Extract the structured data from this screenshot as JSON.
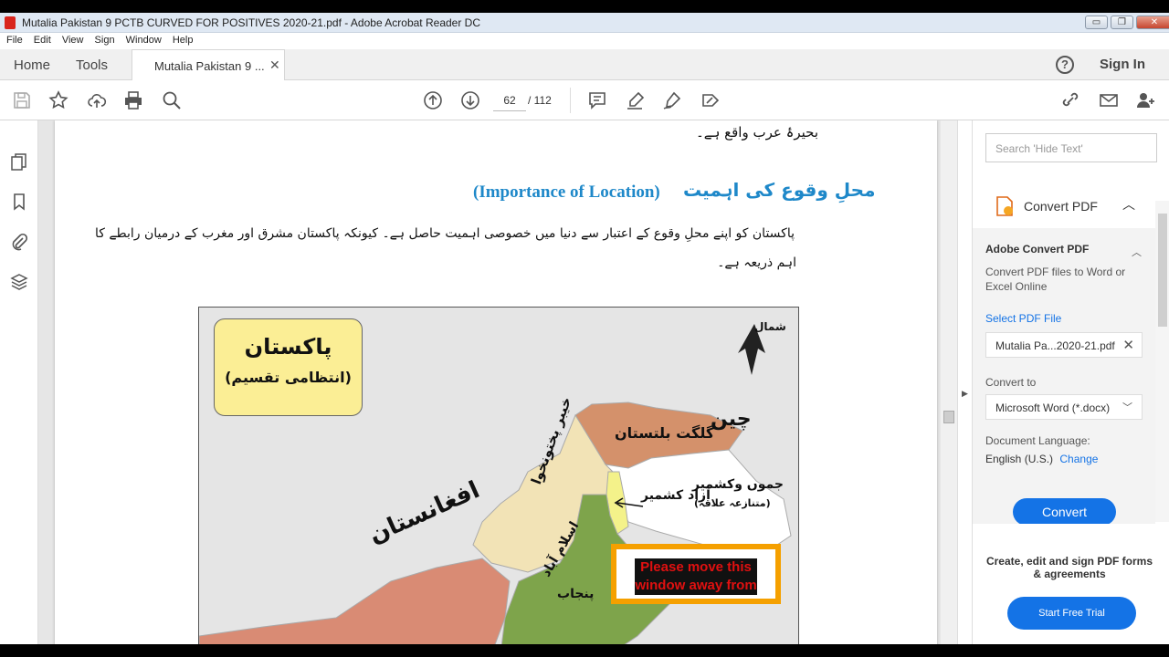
{
  "window": {
    "title": "Mutalia Pakistan 9 PCTB CURVED FOR POSITIVES 2020-21.pdf - Adobe Acrobat Reader DC",
    "min": "▭",
    "max": "❐",
    "close": "✕"
  },
  "menu": [
    "File",
    "Edit",
    "View",
    "Sign",
    "Window",
    "Help"
  ],
  "tabs": {
    "home": "Home",
    "tools": "Tools",
    "doc": "Mutalia Pakistan 9 ...",
    "close": "✕",
    "help": "?",
    "signin": "Sign In"
  },
  "toolbar": {
    "page_current": "62",
    "page_total": "/ 112"
  },
  "document": {
    "line_top": "بحیرۂ عرب واقع ہے۔",
    "heading_urdu": "محلِ وقوع کی اہمیت",
    "heading_english": "(Importance of Location)",
    "para_line1": "پاکستان کو اپنے محلِ وقوع کے اعتبار سے دنیا میں خصوصی اہمیت حاصل ہے۔ کیونکہ پاکستان مشرق اور مغرب کے درمیان رابطے کا",
    "para_line2": "اہم ذریعہ ہے۔",
    "map": {
      "legend_title": "پاکستان",
      "legend_subtitle": "(انتظامی تقسیم)",
      "north": "شمال",
      "china": "چین",
      "gilgit": "گلگت بلتستان",
      "kashmir": "جموں وکشمیر",
      "kashmir_note": "(متنازعہ علاقہ)",
      "azad_kashmir": "آزاد کشمیر",
      "kpk": "خیبر پختونخوا",
      "afghanistan": "افغانستان",
      "islamabad": "اسلام آباد",
      "punjab": "پنجاب",
      "colors": {
        "gilgit": "#d4916b",
        "kpk": "#f2e3b6",
        "punjab": "#7ea44b",
        "azad": "#f4f28a",
        "kashmir": "#ffffff",
        "balochistan": "#d98b74",
        "background": "#e5e5e5"
      }
    },
    "popup": "Please move this window away from"
  },
  "right_panel": {
    "search_placeholder": "Search 'Hide Text'",
    "convert_header": "Convert PDF",
    "section_title": "Adobe Convert PDF",
    "section_desc": "Convert PDF files to Word or Excel Online",
    "select_link": "Select PDF File",
    "file_name": "Mutalia Pa...2020-21.pdf",
    "convert_to_label": "Convert to",
    "convert_to_value": "Microsoft Word (*.docx)",
    "doc_lang_label": "Document Language:",
    "doc_lang_value": "English (U.S.)",
    "change_link": "Change",
    "convert_button": "Convert",
    "promo_text": "Create, edit and sign PDF forms & agreements",
    "promo_button": "Start Free Trial"
  }
}
